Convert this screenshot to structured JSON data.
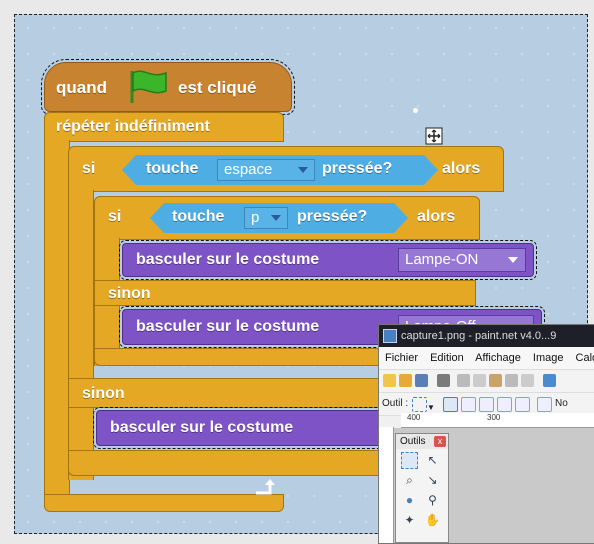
{
  "script": {
    "hat_label_start": "quand",
    "hat_label_end": "est cliqué",
    "forever_label": "répéter indéfiniment",
    "if_outer": {
      "si": "si",
      "touche": "touche",
      "key": "espace",
      "pressed": "pressée?",
      "alors": "alors"
    },
    "if_inner": {
      "si": "si",
      "touche": "touche",
      "key": "p",
      "pressed": "pressée?",
      "alors": "alors"
    },
    "switch_1": {
      "label": "basculer sur le costume",
      "value": "Lampe-ON"
    },
    "else_inner": "sinon",
    "switch_2": {
      "label": "basculer sur le costume",
      "value": "Lampe-Off"
    },
    "else_outer": "sinon",
    "switch_3": {
      "label": "basculer sur le costume"
    }
  },
  "paintnet": {
    "title": "capture1.png - paint.net v4.0...9",
    "menu": [
      "Fichier",
      "Edition",
      "Affichage",
      "Image",
      "Calque"
    ],
    "tool_label": "Outil :",
    "tb2_suffix": "No",
    "ruler_a": "400",
    "ruler_b": "300",
    "tools_title": "Outils",
    "tools_close": "x"
  },
  "colors": {
    "control": "#e4a824",
    "events": "#c88330",
    "looks": "#7e53c5",
    "sensing": "#4eaee3",
    "stage_bg": "#b7cde2"
  },
  "icons": [
    "green-flag-icon",
    "move-icon",
    "loop-arrow-icon",
    "dropdown-arrow-icon",
    "close-icon"
  ]
}
